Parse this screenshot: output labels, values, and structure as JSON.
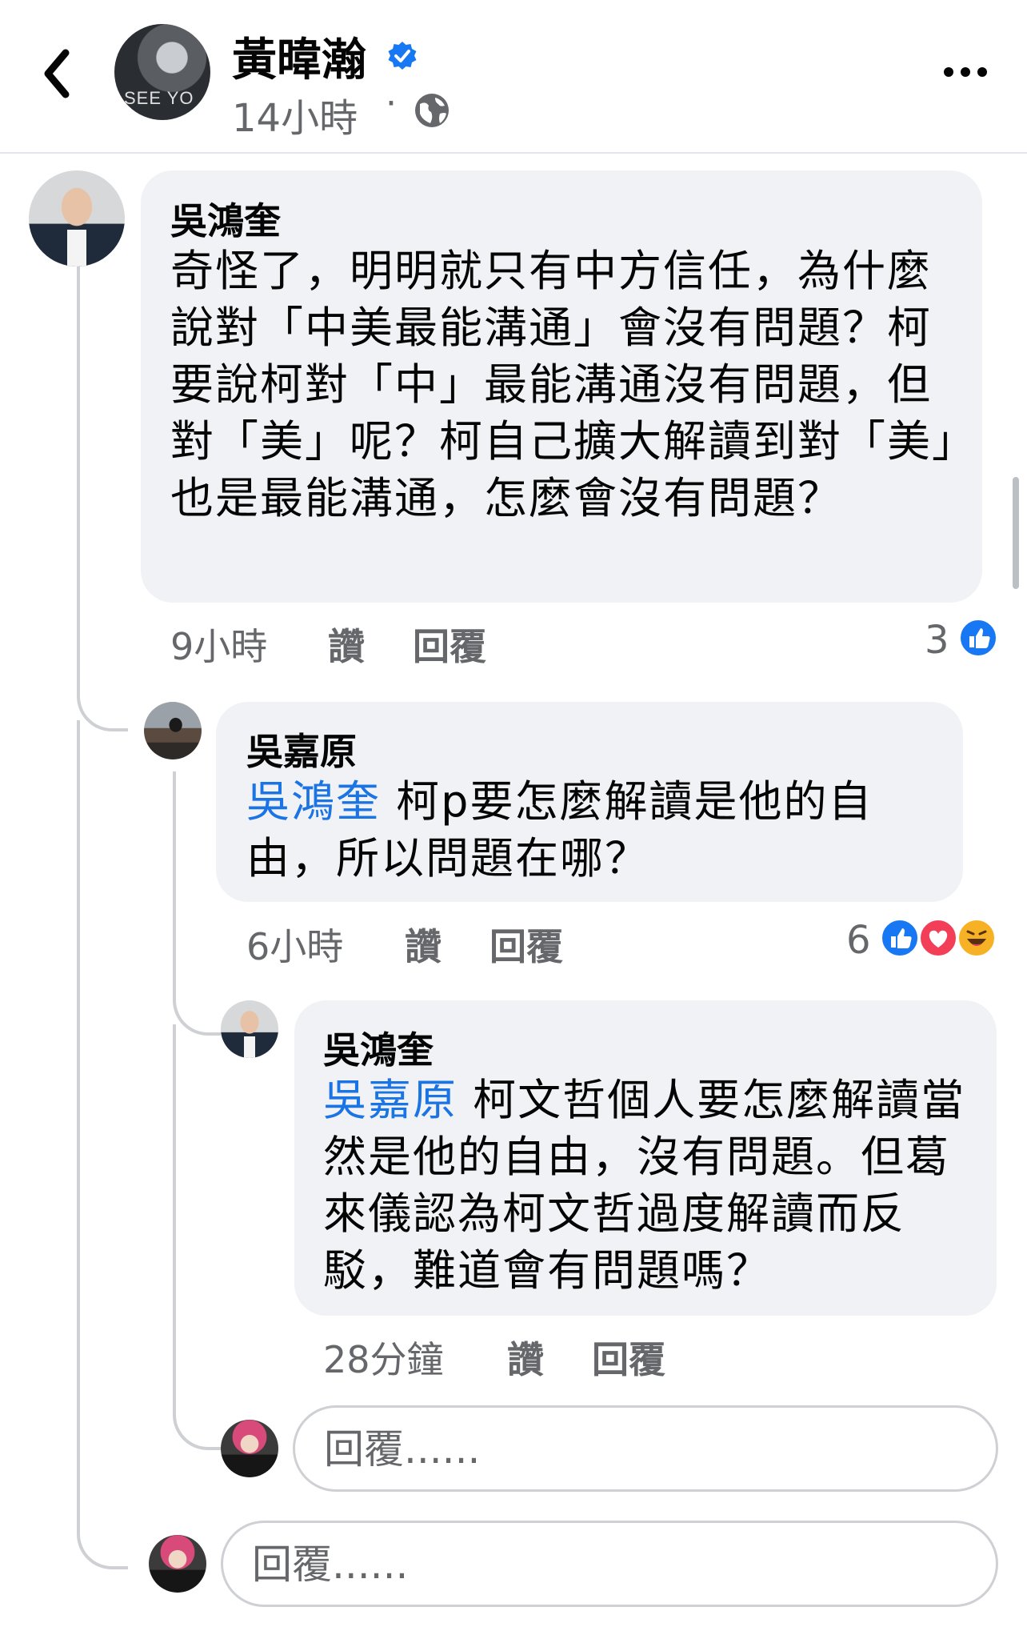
{
  "header": {
    "page_name": "黃暐瀚",
    "avatar_text": "SEE YO",
    "time": "14小時",
    "separator": "·",
    "verified_icon": "verified-badge-icon",
    "privacy_icon": "globe-icon",
    "more_icon": "more-options-icon",
    "back_icon": "chevron-left-icon"
  },
  "comments": [
    {
      "author": "吳鴻奎",
      "text": "奇怪了，明明就只有中方信任，為什麼說對「中美最能溝通」會沒有問題？柯要說柯對「中」最能溝通沒有問題，但對「美」呢？柯自己擴大解讀到對「美」也是最能溝通，怎麼會沒有問題？",
      "time": "9小時",
      "like_label": "讚",
      "reply_label": "回覆",
      "reaction_count": "3",
      "reactions": [
        "like"
      ]
    },
    {
      "author": "吳嘉原",
      "mention": "吳鴻奎",
      "text": " 柯p要怎麼解讀是他的自由，所以問題在哪？",
      "time": "6小時",
      "like_label": "讚",
      "reply_label": "回覆",
      "reaction_count": "6",
      "reactions": [
        "like",
        "love",
        "haha"
      ]
    },
    {
      "author": "吳鴻奎",
      "mention": "吳嘉原",
      "text": " 柯文哲個人要怎麼解讀當然是他的自由，沒有問題。但葛來儀認為柯文哲過度解讀而反駁，難道會有問題嗎？",
      "time": "28分鐘",
      "like_label": "讚",
      "reply_label": "回覆"
    }
  ],
  "reply_inputs": {
    "nested_placeholder": "回覆......",
    "thread_placeholder": "回覆......"
  },
  "colors": {
    "mention": "#1b74e4",
    "like": "#1877f2",
    "love": "#f33e58",
    "haha": "#f7b125",
    "bubble": "#f0f2f5",
    "meta": "#65676b"
  }
}
